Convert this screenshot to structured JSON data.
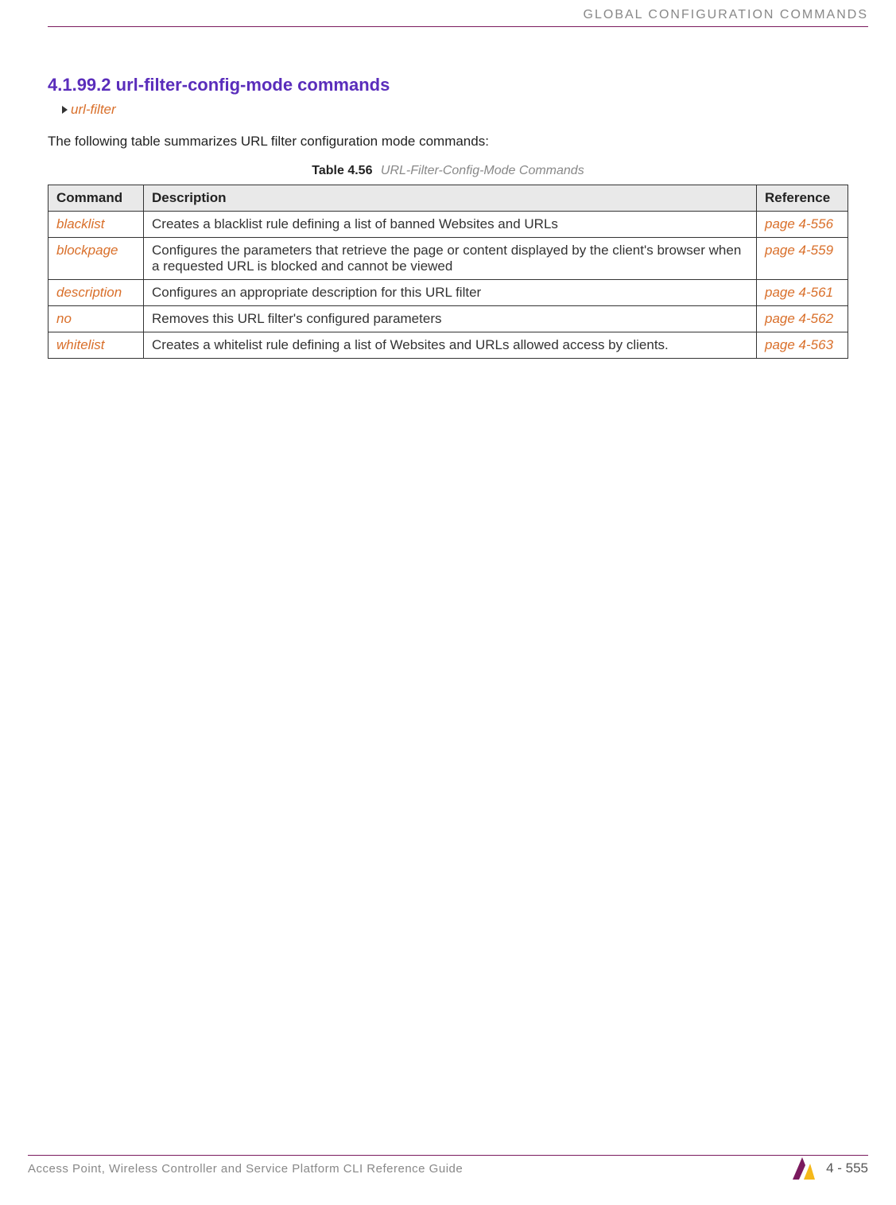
{
  "header": {
    "title": "GLOBAL CONFIGURATION COMMANDS"
  },
  "section": {
    "heading": "4.1.99.2 url-filter-config-mode commands",
    "breadcrumb": "url-filter",
    "intro": "The following table summarizes URL filter configuration mode commands:"
  },
  "table": {
    "caption_label": "Table 4.56",
    "caption_title": "URL-Filter-Config-Mode Commands",
    "headers": {
      "command": "Command",
      "description": "Description",
      "reference": "Reference"
    },
    "rows": [
      {
        "command": "blacklist",
        "description": "Creates a blacklist rule defining a list of banned Websites and URLs",
        "reference": "page 4-556"
      },
      {
        "command": "blockpage",
        "description": "Configures the parameters that retrieve the page or content displayed by the client's browser when a requested URL is blocked and cannot be viewed",
        "reference": "page 4-559"
      },
      {
        "command": "description",
        "description": "Configures an appropriate description for this URL filter",
        "reference": "page 4-561"
      },
      {
        "command": "no",
        "description": "Removes this URL filter's configured parameters",
        "reference": "page 4-562"
      },
      {
        "command": "whitelist",
        "description": "Creates a whitelist rule defining a list of Websites and URLs allowed access by clients.",
        "reference": "page 4-563"
      }
    ]
  },
  "footer": {
    "guide": "Access Point, Wireless Controller and Service Platform CLI Reference Guide",
    "page": "4 - 555"
  }
}
